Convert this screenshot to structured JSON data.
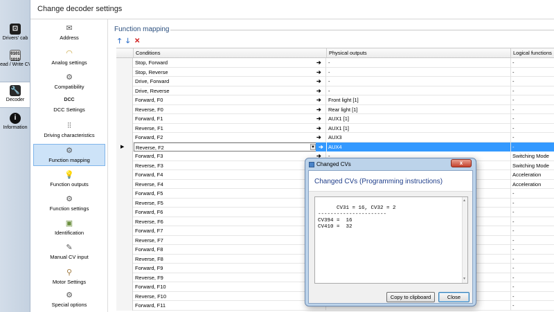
{
  "header": {
    "title": "Change decoder settings"
  },
  "rail": {
    "items": [
      {
        "label": "Drivers' cab",
        "icon": "cab-icon"
      },
      {
        "label": "Read / Write CVs",
        "icon": "binary-icon"
      },
      {
        "label": "Decoder",
        "icon": "wrench-icon"
      },
      {
        "label": "Information",
        "icon": "info-icon"
      }
    ]
  },
  "categories": [
    {
      "label": "Address",
      "icon": "envelope-icon"
    },
    {
      "label": "Analog settings",
      "icon": "analog-gauge-icon"
    },
    {
      "label": "Compatibility",
      "icon": "compatibility-icon"
    },
    {
      "label": "DCC Settings",
      "icon": "dcc-icon",
      "icon_text": "DCC"
    },
    {
      "label": "Driving characteristics",
      "icon": "sliders-icon"
    },
    {
      "label": "Function mapping",
      "icon": "function-mapping-icon"
    },
    {
      "label": "Function outputs",
      "icon": "lightbulb-icon"
    },
    {
      "label": "Function settings",
      "icon": "function-settings-icon"
    },
    {
      "label": "Identification",
      "icon": "id-card-icon"
    },
    {
      "label": "Manual CV input",
      "icon": "manual-input-icon"
    },
    {
      "label": "Motor Settings",
      "icon": "motor-icon"
    },
    {
      "label": "Special options",
      "icon": "special-options-icon"
    }
  ],
  "function_mapping": {
    "title": "Function mapping",
    "toolbar": {
      "up_icon": "arrow-up-icon",
      "down_icon": "arrow-down-icon",
      "delete_icon": "delete-icon"
    },
    "columns": {
      "conditions": "Conditions",
      "physical": "Physical outputs",
      "logical": "Logical functions"
    },
    "rows": [
      {
        "cond": "Stop, Forward",
        "phys": "-",
        "logi": "-"
      },
      {
        "cond": "Stop, Reverse",
        "phys": "-",
        "logi": "-"
      },
      {
        "cond": "Drive, Forward",
        "phys": "-",
        "logi": "-"
      },
      {
        "cond": "Drive, Reverse",
        "phys": "-",
        "logi": "-"
      },
      {
        "cond": "Forward, F0",
        "phys": "Front light [1]",
        "logi": "-"
      },
      {
        "cond": "Reverse, F0",
        "phys": "Rear light [1]",
        "logi": "-"
      },
      {
        "cond": "Forward, F1",
        "phys": "AUX1 [1]",
        "logi": "-"
      },
      {
        "cond": "Reverse, F1",
        "phys": "AUX1 [1]",
        "logi": "-"
      },
      {
        "cond": "Forward, F2",
        "phys": "AUX3",
        "logi": "-"
      },
      {
        "cond": "Reverse, F2",
        "phys": "AUX4",
        "logi": "-"
      },
      {
        "cond": "Forward, F3",
        "phys": "-",
        "logi": "Switching Mode"
      },
      {
        "cond": "Reverse, F3",
        "phys": "",
        "logi": "Switching Mode"
      },
      {
        "cond": "Forward, F4",
        "phys": "",
        "logi": "Acceleration"
      },
      {
        "cond": "Reverse, F4",
        "phys": "",
        "logi": "Acceleration"
      },
      {
        "cond": "Forward, F5",
        "phys": "",
        "logi": "-"
      },
      {
        "cond": "Reverse, F5",
        "phys": "",
        "logi": "-"
      },
      {
        "cond": "Forward, F6",
        "phys": "",
        "logi": "-"
      },
      {
        "cond": "Reverse, F6",
        "phys": "",
        "logi": "-"
      },
      {
        "cond": "Forward, F7",
        "phys": "",
        "logi": "-"
      },
      {
        "cond": "Reverse, F7",
        "phys": "",
        "logi": "-"
      },
      {
        "cond": "Forward, F8",
        "phys": "",
        "logi": "-"
      },
      {
        "cond": "Reverse, F8",
        "phys": "",
        "logi": "-"
      },
      {
        "cond": "Forward, F9",
        "phys": "",
        "logi": "-"
      },
      {
        "cond": "Reverse, F9",
        "phys": "",
        "logi": "-"
      },
      {
        "cond": "Forward, F10",
        "phys": "",
        "logi": "-"
      },
      {
        "cond": "Reverse, F10",
        "phys": "",
        "logi": "-"
      },
      {
        "cond": "Forward, F11",
        "phys": "",
        "logi": "-"
      }
    ],
    "selected_row": 9
  },
  "dialog": {
    "title": "Changed CVs",
    "heading": "Changed CVs (Programming instructions)",
    "text": "CV31 = 16, CV32 = 2\n----------------------\nCV394 =  16\nCV410 =  32",
    "copy_label": "Copy to clipboard",
    "close_label": "Close",
    "close_glyph": "x"
  },
  "colors": {
    "selection": "#3399ff",
    "heading": "#1f3e8a",
    "accent": "#2b4f7e"
  }
}
